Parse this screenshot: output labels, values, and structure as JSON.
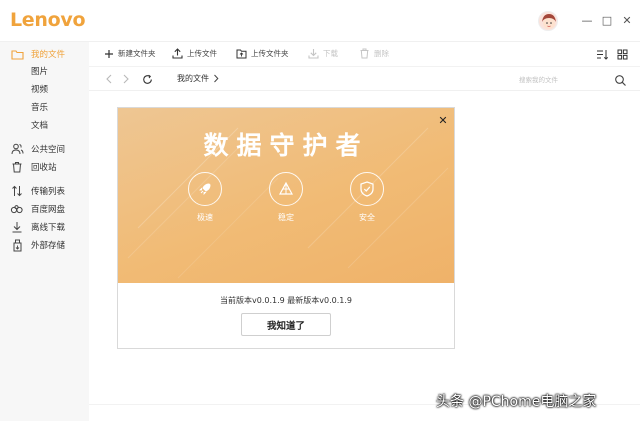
{
  "app": {
    "logo": "Lenovo"
  },
  "window": {
    "minimize": "—",
    "maximize": "□",
    "close": "✕"
  },
  "sidebar": {
    "items": [
      {
        "label": "我的文件",
        "icon": "folder-icon",
        "active": true
      },
      {
        "label": "公共空间",
        "icon": "people-icon"
      },
      {
        "label": "回收站",
        "icon": "trash-icon"
      },
      {
        "label": "传输列表",
        "icon": "transfer-icon"
      },
      {
        "label": "百度网盘",
        "icon": "cloud-icon"
      },
      {
        "label": "离线下载",
        "icon": "download-icon"
      },
      {
        "label": "外部存储",
        "icon": "usb-icon"
      }
    ],
    "subitems": [
      "图片",
      "视频",
      "音乐",
      "文档"
    ]
  },
  "toolbar": {
    "new_folder": "新建文件夹",
    "upload_file": "上传文件",
    "upload_folder": "上传文件夹",
    "download": "下载",
    "delete": "删除"
  },
  "navbar": {
    "breadcrumb": "我的文件",
    "search_placeholder": "搜索我的文件"
  },
  "dialog": {
    "title": "数据守护者",
    "features": [
      {
        "label": "极速",
        "icon": "rocket-icon"
      },
      {
        "label": "稳定",
        "icon": "pyramid-icon"
      },
      {
        "label": "安全",
        "icon": "shield-icon"
      }
    ],
    "version_text": "当前版本v0.0.1.9 最新版本v0.0.1.9",
    "ok_label": "我知道了"
  },
  "watermark": "头条 @PChome电脑之家",
  "colors": {
    "accent": "#f0a33c",
    "banner": "#f1bb75"
  }
}
